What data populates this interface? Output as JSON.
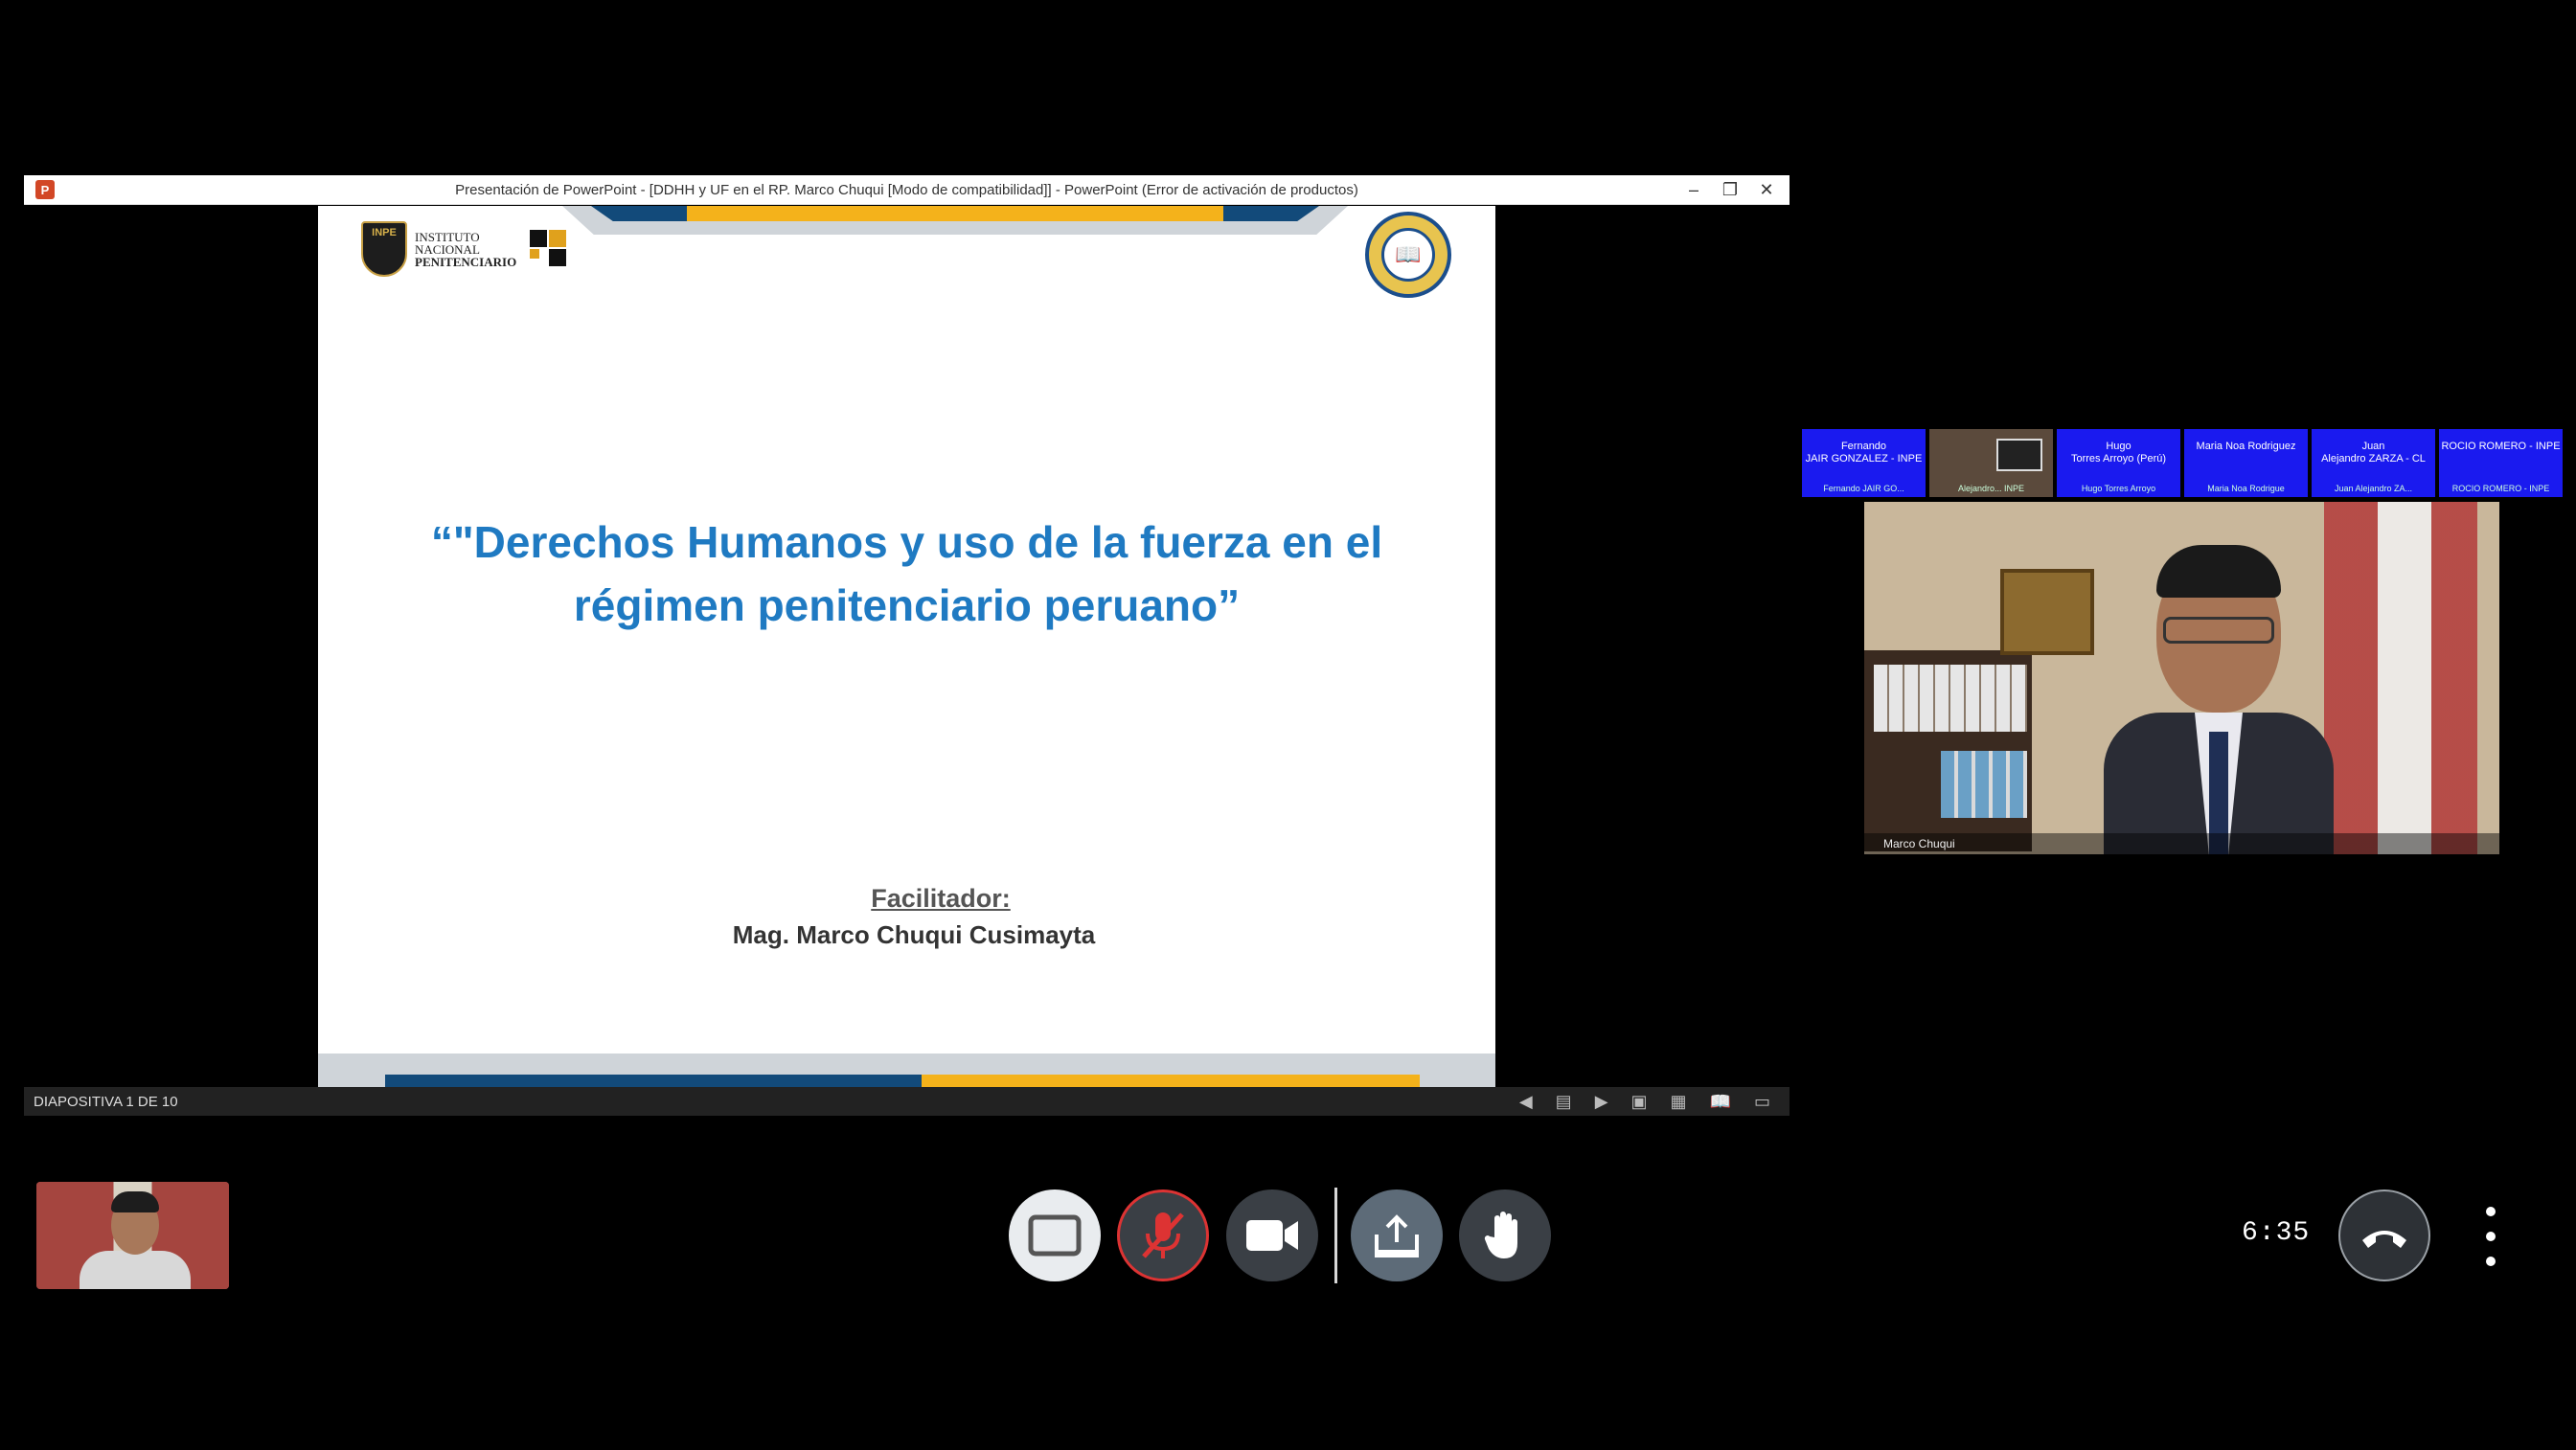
{
  "ppt": {
    "window_title": "Presentación de PowerPoint - [DDHH y UF en el RP. Marco Chuqui [Modo de compatibilidad]] - PowerPoint (Error de activación de productos)",
    "status_text": "DIAPOSITIVA 1 DE 10",
    "icons": [
      "powerpoint-icon",
      "minimize-icon",
      "restore-icon",
      "close-icon",
      "prev-slide-icon",
      "slide-sorter-icon",
      "next-slide-icon",
      "normal-view-icon",
      "grid-view-icon",
      "reading-view-icon",
      "slideshow-icon"
    ]
  },
  "slide": {
    "title_line1": "“\"Derechos Humanos y uso de la fuerza en el",
    "title_line2": "régimen penitenciario peruano”",
    "facilitator_label": "Facilitador:",
    "facilitator_name": "Mag. Marco Chuqui Cusimayta",
    "logo_lines": [
      "INSTITUTO",
      "NACIONAL",
      "PENITENCIARIO"
    ],
    "shield_text": "INPE",
    "title_color": "#1f7ac2"
  },
  "participants": [
    {
      "name": "Fernando\nJAIR GONZALEZ - INPE",
      "footer": "Fernando JAIR GO..."
    },
    {
      "name": "",
      "footer": "Alejandro... INPE",
      "video": true
    },
    {
      "name": "Hugo\nTorres Arroyo (Perú)",
      "footer": "Hugo Torres Arroyo"
    },
    {
      "name": "Maria Noa Rodriguez",
      "footer": "Maria Noa Rodrigue"
    },
    {
      "name": "Juan\nAlejandro ZARZA - CL",
      "footer": "Juan Alejandro ZA..."
    },
    {
      "name": "ROCIO ROMERO - INPE",
      "footer": "ROCIO ROMERO - INPE"
    }
  ],
  "speaker": {
    "name": "Marco Chuqui"
  },
  "controls": {
    "timer": "6:35",
    "mic_state_color": "#dd3333",
    "icons": [
      "screen-icon",
      "mic-off-icon",
      "camera-icon",
      "share-icon",
      "hand-icon",
      "hangup-icon",
      "more-icon"
    ]
  }
}
